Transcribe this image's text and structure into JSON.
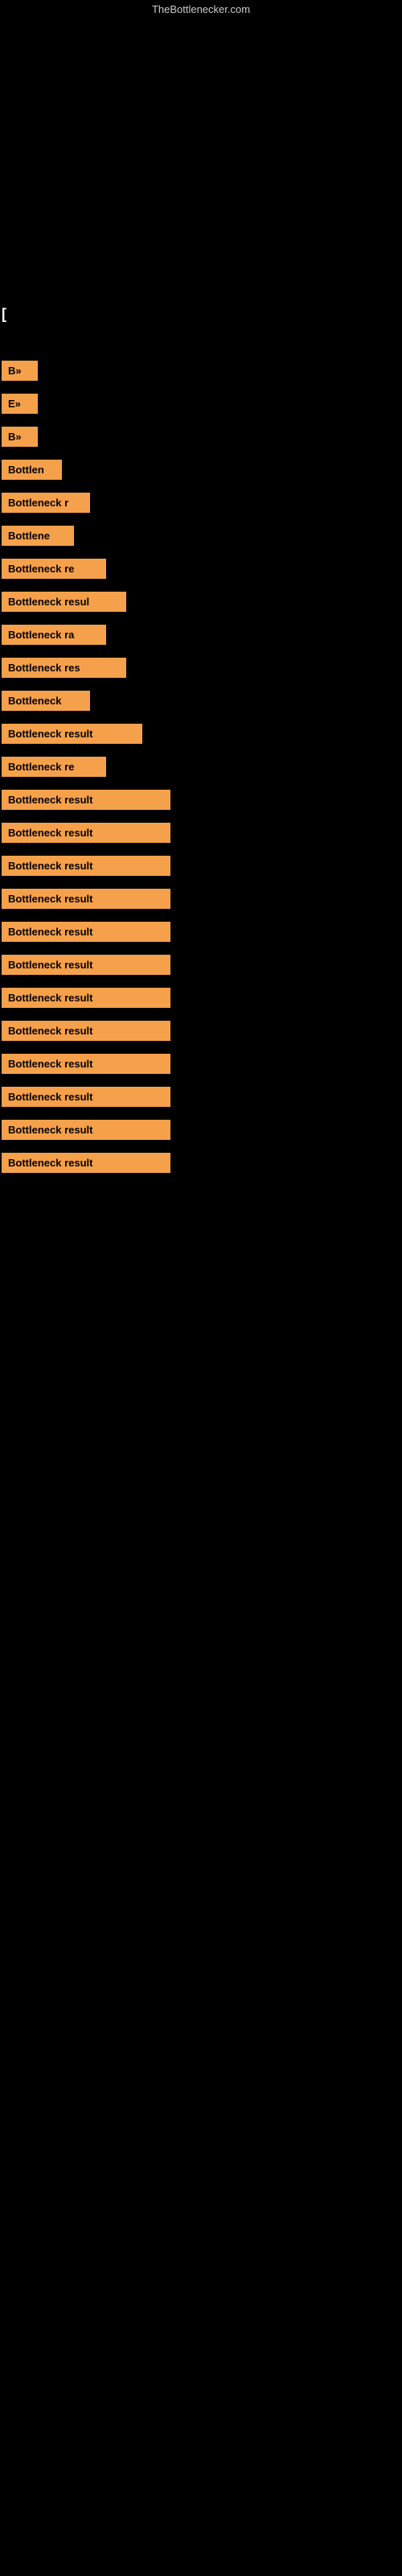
{
  "site": {
    "title": "TheBottlenecker.com"
  },
  "header": {
    "label": "["
  },
  "rows": [
    {
      "id": 1,
      "label": "B»",
      "width_class": "short-2"
    },
    {
      "id": 2,
      "label": "E»",
      "width_class": "short-2"
    },
    {
      "id": 3,
      "label": "B»",
      "width_class": "short-2"
    },
    {
      "id": 4,
      "label": "Bottlen",
      "width_class": "short-4"
    },
    {
      "id": 5,
      "label": "Bottleneck r",
      "width_class": "short-6"
    },
    {
      "id": 6,
      "label": "Bottlene",
      "width_class": "short-5"
    },
    {
      "id": 7,
      "label": "Bottleneck re",
      "width_class": "short-7"
    },
    {
      "id": 8,
      "label": "Bottleneck resul",
      "width_class": "short-8"
    },
    {
      "id": 9,
      "label": "Bottleneck ra",
      "width_class": "short-7"
    },
    {
      "id": 10,
      "label": "Bottleneck res",
      "width_class": "short-8"
    },
    {
      "id": 11,
      "label": "Bottleneck",
      "width_class": "short-6"
    },
    {
      "id": 12,
      "label": "Bottleneck result",
      "width_class": "short-9"
    },
    {
      "id": 13,
      "label": "Bottleneck re",
      "width_class": "short-7"
    },
    {
      "id": 14,
      "label": "Bottleneck result",
      "width_class": "full"
    },
    {
      "id": 15,
      "label": "Bottleneck result",
      "width_class": "full"
    },
    {
      "id": 16,
      "label": "Bottleneck result",
      "width_class": "full"
    },
    {
      "id": 17,
      "label": "Bottleneck result",
      "width_class": "full"
    },
    {
      "id": 18,
      "label": "Bottleneck result",
      "width_class": "full"
    },
    {
      "id": 19,
      "label": "Bottleneck result",
      "width_class": "full"
    },
    {
      "id": 20,
      "label": "Bottleneck result",
      "width_class": "full"
    },
    {
      "id": 21,
      "label": "Bottleneck result",
      "width_class": "full"
    },
    {
      "id": 22,
      "label": "Bottleneck result",
      "width_class": "full"
    },
    {
      "id": 23,
      "label": "Bottleneck result",
      "width_class": "full"
    },
    {
      "id": 24,
      "label": "Bottleneck result",
      "width_class": "full"
    },
    {
      "id": 25,
      "label": "Bottleneck result",
      "width_class": "full"
    }
  ]
}
